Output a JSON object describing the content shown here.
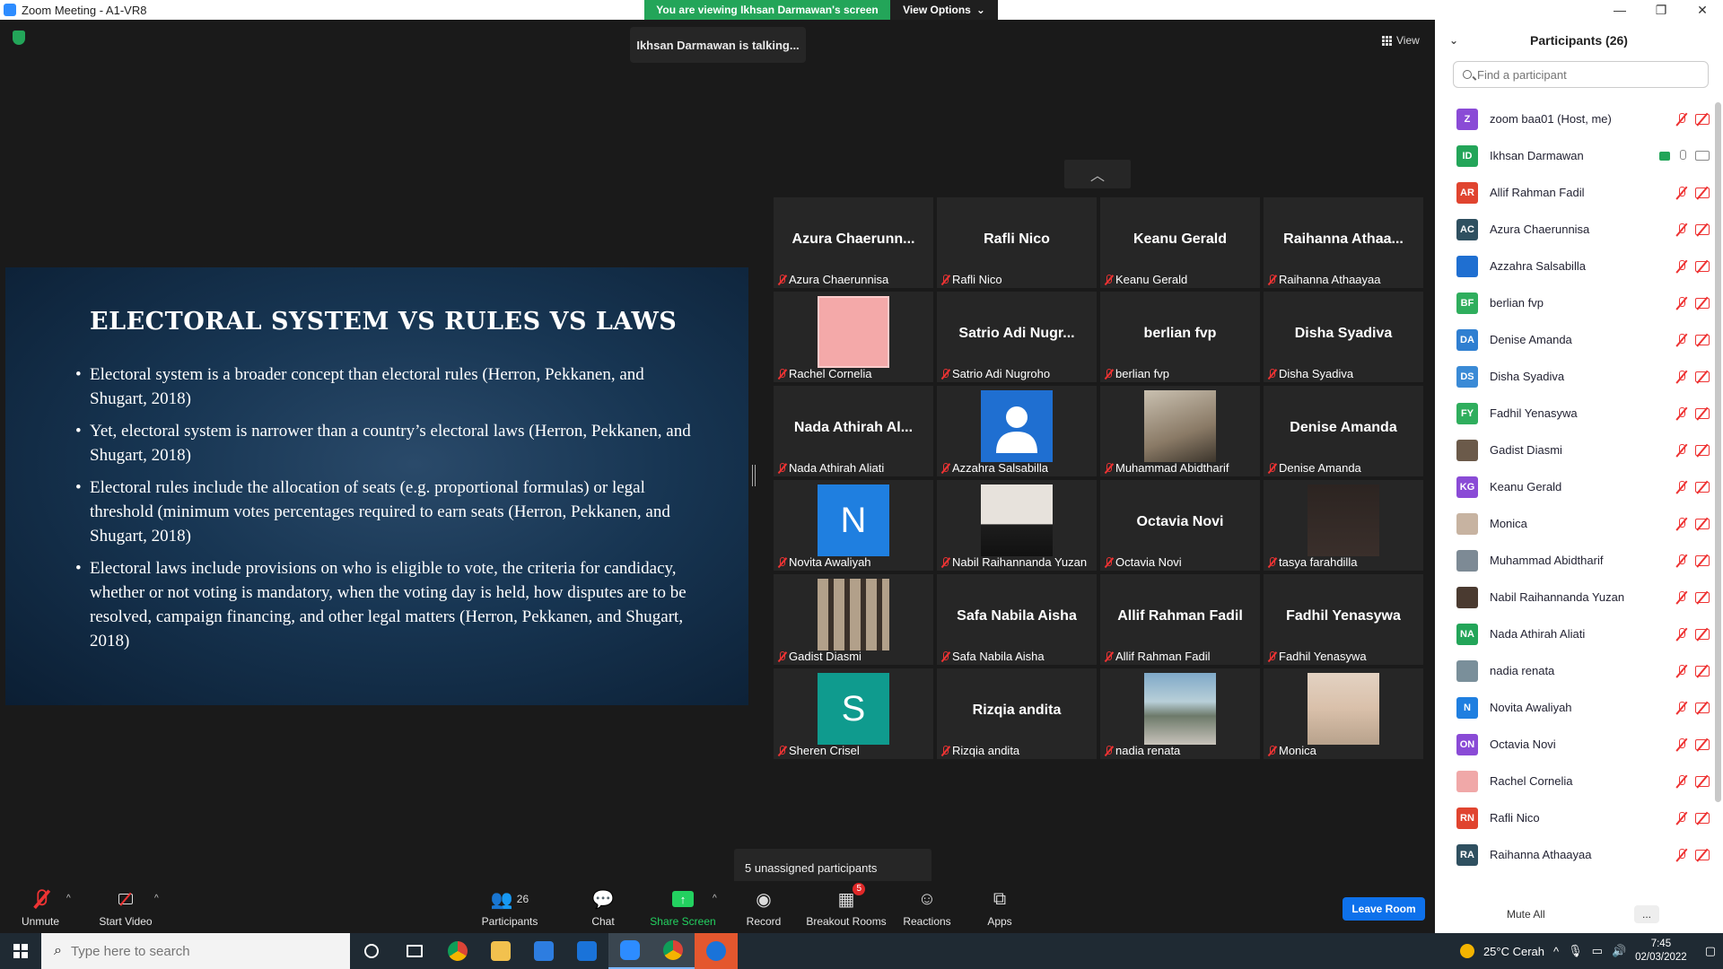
{
  "window": {
    "title": "Zoom Meeting - A1-VR8"
  },
  "banner": {
    "viewing": "You are viewing Ikhsan Darmawan's screen",
    "view_options": "View Options"
  },
  "talking": "Ikhsan Darmawan is talking...",
  "view_button": "View",
  "slide": {
    "title": "ELECTORAL SYSTEM VS RULES VS LAWS",
    "bullets": [
      "Electoral system is a broader concept than electoral rules (Herron, Pekkanen, and Shugart, 2018)",
      "Yet, electoral system is narrower than a country’s electoral laws (Herron, Pekkanen, and Shugart, 2018)",
      "Electoral rules include the allocation of seats (e.g. proportional formulas) or legal threshold (minimum votes percentages required to earn seats (Herron, Pekkanen, and Shugart, 2018)",
      "Electoral laws include provisions on who is eligible to vote, the criteria for candidacy, whether or not voting is mandatory, when the voting day is held, how disputes are to be resolved, campaign financing, and other legal matters (Herron, Pekkanen, and Shugart, 2018)"
    ]
  },
  "gallery": {
    "tiles": [
      {
        "big": "Azura  Chaerunn...",
        "label": "Azura Chaerunnisa"
      },
      {
        "big": "Rafli Nico",
        "label": "Rafli Nico"
      },
      {
        "big": "Keanu Gerald",
        "label": "Keanu Gerald"
      },
      {
        "big": "Raihanna  Athaa...",
        "label": "Raihanna Athaayaa"
      },
      {
        "big": "",
        "label": "Rachel Cornelia"
      },
      {
        "big": "Satrio Adi  Nugr...",
        "label": "Satrio Adi Nugroho"
      },
      {
        "big": "berlian fvp",
        "label": "berlian fvp"
      },
      {
        "big": "Disha Syadiva",
        "label": "Disha Syadiva"
      },
      {
        "big": "Nada Athirah  Al...",
        "label": "Nada Athirah Aliati"
      },
      {
        "big": "",
        "label": "Azzahra Salsabilla"
      },
      {
        "big": "",
        "label": "Muhammad Abidtharif"
      },
      {
        "big": "Denise Amanda",
        "label": "Denise Amanda"
      },
      {
        "big": "N",
        "label": "Novita Awaliyah"
      },
      {
        "big": "",
        "label": "Nabil Raihannanda Yuzan"
      },
      {
        "big": "Octavia Novi",
        "label": "Octavia Novi"
      },
      {
        "big": "",
        "label": "tasya farahdilla"
      },
      {
        "big": "",
        "label": "Gadist Diasmi"
      },
      {
        "big": "Safa Nabila Aisha",
        "label": "Safa Nabila Aisha"
      },
      {
        "big": "Allif Rahman Fadil",
        "label": "Allif Rahman Fadil"
      },
      {
        "big": "Fadhil Yenasywa",
        "label": "Fadhil Yenasywa"
      },
      {
        "big": "S",
        "label": "Sheren Crisel"
      },
      {
        "big": "Rizqia andita",
        "label": "Rizqia andita"
      },
      {
        "big": "",
        "label": "nadia renata"
      },
      {
        "big": "",
        "label": "Monica"
      }
    ]
  },
  "unassigned": "5 unassigned participants",
  "toolbar": {
    "unmute": "Unmute",
    "start_video": "Start Video",
    "participants": "Participants",
    "participants_count": "26",
    "chat": "Chat",
    "share_screen": "Share Screen",
    "record": "Record",
    "breakout_rooms": "Breakout Rooms",
    "breakout_badge": "5",
    "reactions": "Reactions",
    "apps": "Apps",
    "leave_room": "Leave Room"
  },
  "panel": {
    "title": "Participants (26)",
    "search_placeholder": "Find a participant",
    "mute_all": "Mute All",
    "more": "...",
    "participants": [
      {
        "initials": "Z",
        "name": "zoom baa01 (Host, me)",
        "color": "#8a4bd6"
      },
      {
        "initials": "ID",
        "name": "Ikhsan Darmawan",
        "color": "#23a559"
      },
      {
        "initials": "AR",
        "name": "Allif Rahman Fadil",
        "color": "#e0442f"
      },
      {
        "initials": "AC",
        "name": "Azura Chaerunnisa",
        "color": "#2f5060"
      },
      {
        "initials": "",
        "name": "Azzahra Salsabilla",
        "color": "#1f6fd1"
      },
      {
        "initials": "BF",
        "name": "berlian fvp",
        "color": "#2fae5d"
      },
      {
        "initials": "DA",
        "name": "Denise Amanda",
        "color": "#2f7fd1"
      },
      {
        "initials": "DS",
        "name": "Disha Syadiva",
        "color": "#3a8ad6"
      },
      {
        "initials": "FY",
        "name": "Fadhil Yenasywa",
        "color": "#2fae5d"
      },
      {
        "initials": "",
        "name": "Gadist Diasmi",
        "color": "#6b5a4a"
      },
      {
        "initials": "KG",
        "name": "Keanu Gerald",
        "color": "#8a4bd6"
      },
      {
        "initials": "",
        "name": "Monica",
        "color": "#c7b3a1"
      },
      {
        "initials": "",
        "name": "Muhammad Abidtharif",
        "color": "#7d8a95"
      },
      {
        "initials": "",
        "name": "Nabil Raihannanda Yuzan",
        "color": "#4a3a30"
      },
      {
        "initials": "NA",
        "name": "Nada Athirah Aliati",
        "color": "#23a559"
      },
      {
        "initials": "",
        "name": "nadia renata",
        "color": "#7a8f9a"
      },
      {
        "initials": "N",
        "name": "Novita Awaliyah",
        "color": "#1f7fe0"
      },
      {
        "initials": "ON",
        "name": "Octavia Novi",
        "color": "#8a4bd6"
      },
      {
        "initials": "",
        "name": "Rachel Cornelia",
        "color": "#f0a8a8"
      },
      {
        "initials": "RN",
        "name": "Rafli Nico",
        "color": "#e0442f"
      },
      {
        "initials": "RA",
        "name": "Raihanna Athaayaa",
        "color": "#2f5060"
      }
    ]
  },
  "taskbar": {
    "search_placeholder": "Type here to search",
    "weather": "25°C  Cerah",
    "time": "7:45",
    "date": "02/03/2022"
  },
  "colors": {
    "accent": "#0e71eb",
    "green": "#23a559",
    "muted_red": "#e33333"
  }
}
